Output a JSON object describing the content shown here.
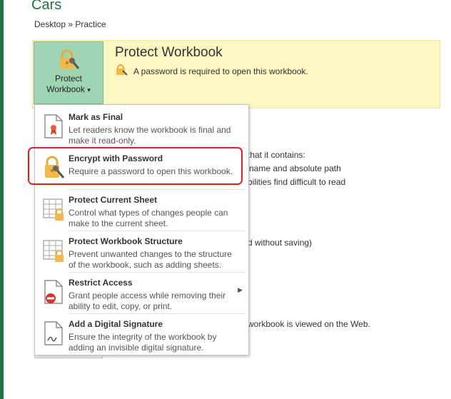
{
  "page": {
    "title": "Cars",
    "breadcrumb": "Desktop » Practice"
  },
  "protect": {
    "button_line1": "Protect",
    "button_line2": "Workbook",
    "dropdown_glyph": "▾",
    "heading": "Protect Workbook",
    "description": "A password is required to open this workbook."
  },
  "background_texts": [
    "that it contains:",
    "name and absolute path",
    "bilities find difficult to read",
    "d without saving)",
    "workbook is viewed on the Web."
  ],
  "menu": {
    "items": [
      {
        "title": "Mark as Final",
        "desc": "Let readers know the workbook is final and make it read-only.",
        "icon": "document-ribbon-icon"
      },
      {
        "title": "Encrypt with Password",
        "desc": "Require a password to open this workbook.",
        "icon": "lock-key-icon"
      },
      {
        "title": "Protect Current Sheet",
        "desc": "Control what types of changes people can make to the current sheet.",
        "icon": "sheet-lock-icon"
      },
      {
        "title": "Protect Workbook Structure",
        "desc": "Prevent unwanted changes to the structure of the workbook, such as adding sheets.",
        "icon": "workbook-structure-lock-icon"
      },
      {
        "title": "Restrict Access",
        "desc": "Grant people access while removing their ability to edit, copy, or print.",
        "icon": "document-no-entry-icon",
        "submenu_glyph": "▶"
      },
      {
        "title": "Add a Digital Signature",
        "desc": "Ensure the integrity of the workbook by adding an invisible digital signature.",
        "icon": "document-signature-icon"
      }
    ]
  },
  "colors": {
    "accent": "#217346",
    "band": "#fcf6c2",
    "button": "#9fd5b3",
    "highlight": "#e02020",
    "lock": "#f2b84b"
  }
}
